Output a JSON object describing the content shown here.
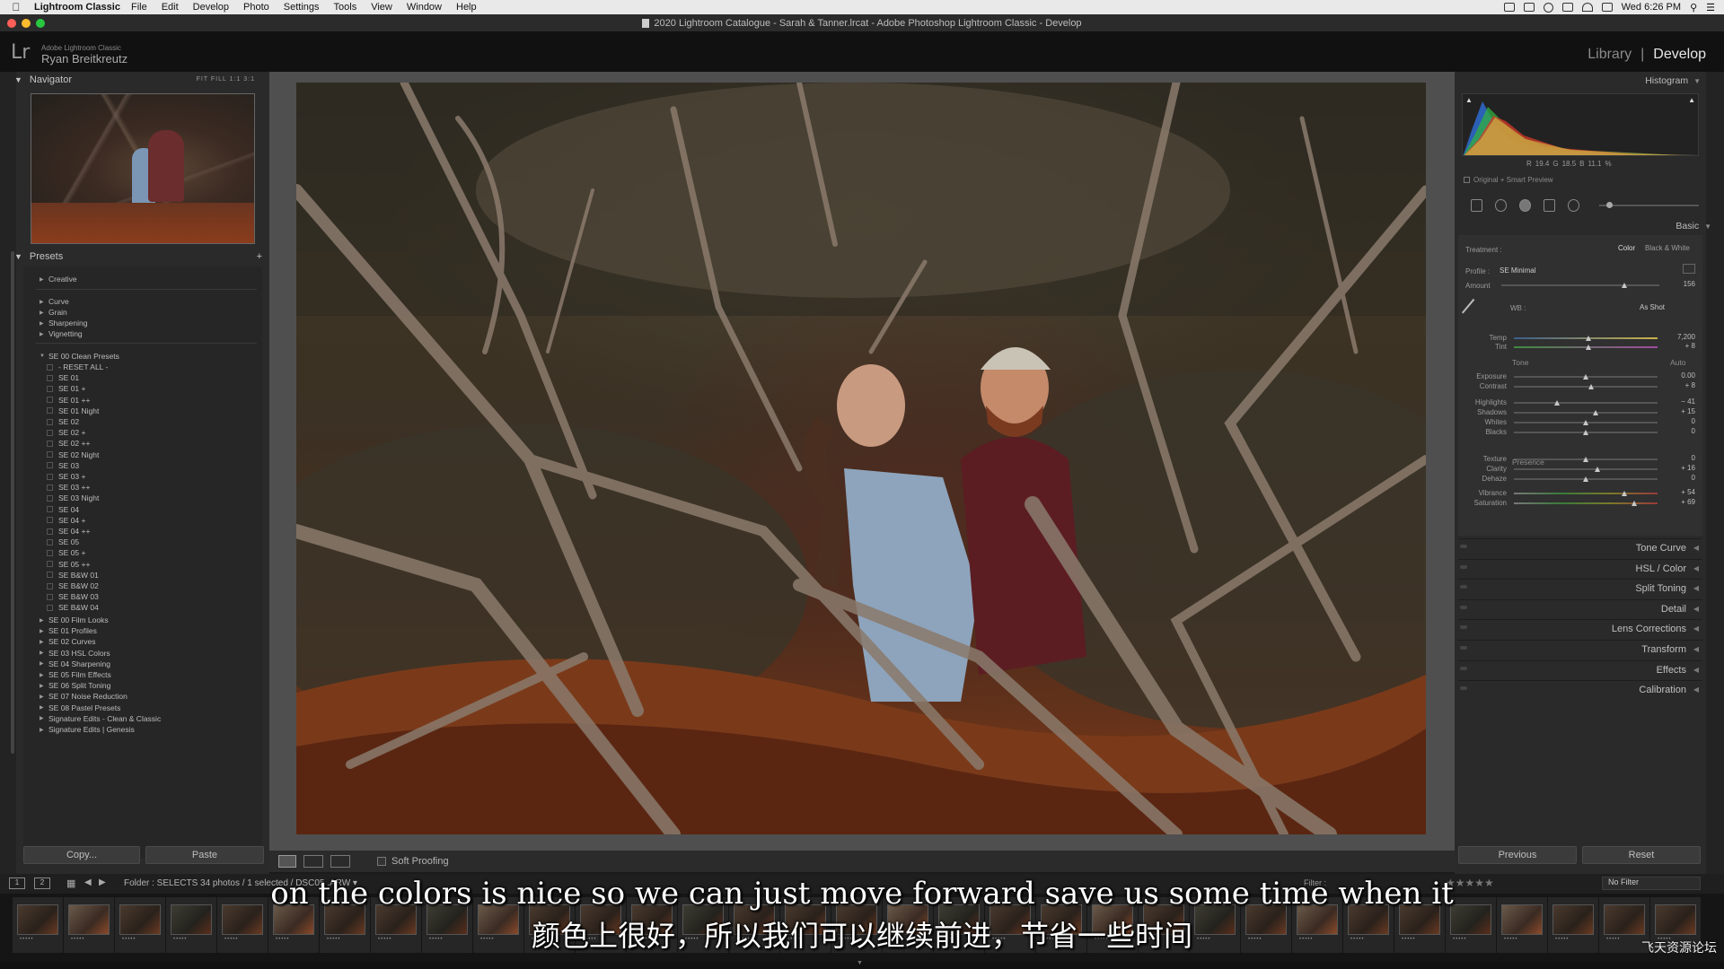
{
  "menubar": {
    "app": "Lightroom Classic",
    "items": [
      "File",
      "Edit",
      "Develop",
      "Photo",
      "Settings",
      "Tools",
      "View",
      "Window",
      "Help"
    ],
    "clock": "Wed 6:26 PM"
  },
  "window": {
    "title": "2020 Lightroom Catalogue - Sarah & Tanner.lrcat - Adobe Photoshop Lightroom Classic - Develop"
  },
  "identity": {
    "product": "Adobe Lightroom Classic",
    "user": "Ryan Breitkreutz",
    "logo": "Lr",
    "modules": [
      "Library",
      "Develop"
    ],
    "active_module": "Develop",
    "separator": "|"
  },
  "navigator": {
    "title": "Navigator",
    "zoom": "FIT  FILL  1:1  3:1"
  },
  "presets": {
    "title": "Presets",
    "add": "+",
    "groups_top": [
      "Creative"
    ],
    "groups_mid": [
      "Curve",
      "Grain",
      "Sharpening",
      "Vignetting"
    ],
    "open_group": "SE 00 Clean Presets",
    "open_items": [
      "- RESET ALL -",
      "SE 01",
      "SE 01 +",
      "SE 01 ++",
      "SE 01 Night",
      "SE 02",
      "SE 02 +",
      "SE 02 ++",
      "SE 02 Night",
      "SE 03",
      "SE 03 +",
      "SE 03 ++",
      "SE 03 Night",
      "SE 04",
      "SE 04 +",
      "SE 04 ++",
      "SE 05",
      "SE 05 +",
      "SE 05 ++",
      "SE B&W 01",
      "SE B&W 02",
      "SE B&W 03",
      "SE B&W 04"
    ],
    "groups_bottom": [
      "SE 00 Film Looks",
      "SE 01 Profiles",
      "SE 02 Curves",
      "SE 03 HSL Colors",
      "SE 04 Sharpening",
      "SE 05 Film Effects",
      "SE 06 Split Toning",
      "SE 07 Noise Reduction",
      "SE 08 Pastel Presets",
      "Signature Edits - Clean & Classic",
      "Signature Edits | Genesis"
    ]
  },
  "left_buttons": {
    "copy": "Copy...",
    "paste": "Paste"
  },
  "toolbar": {
    "soft_proofing": "Soft Proofing"
  },
  "histogram": {
    "title": "Histogram",
    "r_label": "R",
    "r": "19.4",
    "g_label": "G",
    "g": "18.5",
    "b_label": "B",
    "b": "11.1",
    "pct": "%",
    "preview": "Original + Smart Preview"
  },
  "basic": {
    "title": "Basic",
    "treatment_label": "Treatment :",
    "treatment_color": "Color",
    "treatment_bw": "Black & White",
    "profile_label": "Profile :",
    "profile_value": "SE Minimal",
    "amount_label": "Amount",
    "amount_value": "156",
    "wb_label": "WB :",
    "wb_value": "As Shot",
    "temp_label": "Temp",
    "temp_value": "7,200",
    "tint_label": "Tint",
    "tint_value": "+ 8",
    "tone_label": "Tone",
    "auto_label": "Auto",
    "exposure_label": "Exposure",
    "exposure_value": "0.00",
    "contrast_label": "Contrast",
    "contrast_value": "+ 8",
    "highlights_label": "Highlights",
    "highlights_value": "− 41",
    "shadows_label": "Shadows",
    "shadows_value": "+ 15",
    "whites_label": "Whites",
    "whites_value": "0",
    "blacks_label": "Blacks",
    "blacks_value": "0",
    "presence_label": "Presence",
    "texture_label": "Texture",
    "texture_value": "0",
    "clarity_label": "Clarity",
    "clarity_value": "+ 16",
    "dehaze_label": "Dehaze",
    "dehaze_value": "0",
    "vibrance_label": "Vibrance",
    "vibrance_value": "+ 54",
    "saturation_label": "Saturation",
    "saturation_value": "+ 69"
  },
  "slider_levels": {
    "amount": 0.78,
    "temp": 0.52,
    "tint": 0.52,
    "exposure": 0.5,
    "contrast": 0.54,
    "highlights": 0.3,
    "shadows": 0.57,
    "whites": 0.5,
    "blacks": 0.5,
    "texture": 0.5,
    "clarity": 0.58,
    "dehaze": 0.5,
    "vibrance": 0.77,
    "saturation": 0.84
  },
  "right_panels": [
    "Tone Curve",
    "HSL / Color",
    "Split Toning",
    "Detail",
    "Lens Corrections",
    "Transform",
    "Effects",
    "Calibration"
  ],
  "right_buttons": {
    "previous": "Previous",
    "reset": "Reset"
  },
  "filmbar": {
    "mon1": "1",
    "mon2": "2",
    "folder_info": "Folder : SELECTS    34 photos / 1 selected / DSC05      .ARW ▾",
    "filter_label": "Filter :",
    "filter_value": "No Filter"
  },
  "subtitles": {
    "en": "on the colors is nice so we can just move forward save us some time when it",
    "zh": "颜色上很好，所以我们可以继续前进，节省一些时间"
  },
  "watermark": "飞天资源论坛"
}
